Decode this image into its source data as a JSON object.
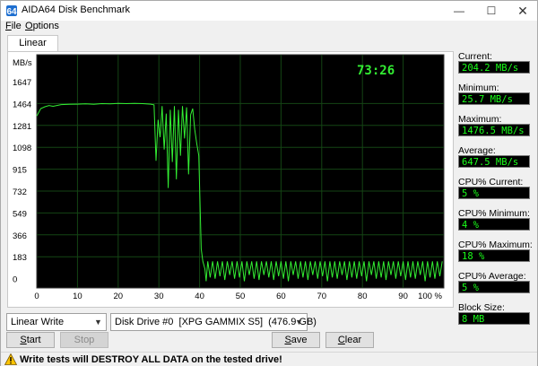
{
  "window": {
    "title": "AIDA64 Disk Benchmark",
    "controls": {
      "minimize": "—",
      "maximize": "☐",
      "close": "✕"
    }
  },
  "menu": [
    {
      "label": "File",
      "accel": "F",
      "rest": "ile"
    },
    {
      "label": "Options",
      "accel": "O",
      "rest": "ptions"
    }
  ],
  "tab": {
    "label": "Linear Write"
  },
  "chart_data": {
    "type": "line",
    "title": "",
    "ylabel": "MB/s",
    "xlabel": "",
    "timer": "73:26",
    "y_ticks": [
      "1647",
      "1464",
      "1281",
      "1098",
      "915",
      "732",
      "549",
      "366",
      "183",
      "0"
    ],
    "x_ticks": [
      "0",
      "10",
      "20",
      "30",
      "40",
      "50",
      "60",
      "70",
      "80",
      "90",
      "100 %"
    ],
    "xlim": [
      0,
      100
    ],
    "ylim": [
      0,
      1647
    ],
    "grid": true,
    "background": "#000000",
    "grid_color": "#144514",
    "line_color": "#33ee33",
    "series": [
      {
        "values": [
          [
            0,
            1370
          ],
          [
            1,
            1430
          ],
          [
            2,
            1445
          ],
          [
            3,
            1455
          ],
          [
            4,
            1448
          ],
          [
            6,
            1462
          ],
          [
            8,
            1465
          ],
          [
            10,
            1466
          ],
          [
            12,
            1468
          ],
          [
            14,
            1465
          ],
          [
            16,
            1470
          ],
          [
            18,
            1468
          ],
          [
            20,
            1472
          ],
          [
            22,
            1470
          ],
          [
            24,
            1472
          ],
          [
            26,
            1470
          ],
          [
            28,
            1466
          ],
          [
            28.8,
            1460
          ],
          [
            29.3,
            1010
          ],
          [
            29.8,
            1340
          ],
          [
            30.3,
            1200
          ],
          [
            30.8,
            1450
          ],
          [
            31.3,
            1100
          ],
          [
            31.8,
            1390
          ],
          [
            32.3,
            790
          ],
          [
            32.8,
            1420
          ],
          [
            33.3,
            1000
          ],
          [
            33.8,
            1450
          ],
          [
            34.3,
            860
          ],
          [
            34.8,
            1420
          ],
          [
            35.3,
            1050
          ],
          [
            35.8,
            1450
          ],
          [
            36.3,
            1190
          ],
          [
            36.8,
            1440
          ],
          [
            37.3,
            900
          ],
          [
            37.8,
            1380
          ],
          [
            38.3,
            1430
          ],
          [
            38.8,
            1260
          ],
          [
            39.3,
            1150
          ],
          [
            39.8,
            1050
          ],
          [
            40.4,
            300
          ],
          [
            40.8,
            200
          ],
          [
            41.3,
            140
          ],
          [
            41.6,
            40
          ],
          [
            42.0,
            200
          ],
          [
            42.6,
            70
          ],
          [
            43.2,
            200
          ],
          [
            43.8,
            60
          ],
          [
            44.4,
            200
          ],
          [
            45.0,
            80
          ],
          [
            45.6,
            200
          ],
          [
            46.2,
            50
          ],
          [
            46.8,
            200
          ],
          [
            47.4,
            90
          ],
          [
            48.0,
            200
          ],
          [
            48.6,
            60
          ],
          [
            49.2,
            200
          ],
          [
            49.8,
            70
          ],
          [
            50.4,
            200
          ],
          [
            51.0,
            40
          ],
          [
            51.6,
            200
          ],
          [
            52.2,
            90
          ],
          [
            52.8,
            200
          ],
          [
            53.4,
            60
          ],
          [
            54.0,
            200
          ],
          [
            54.6,
            50
          ],
          [
            55.2,
            200
          ],
          [
            55.8,
            90
          ],
          [
            56.4,
            200
          ],
          [
            57.0,
            70
          ],
          [
            57.6,
            200
          ],
          [
            58.2,
            50
          ],
          [
            58.8,
            200
          ],
          [
            59.4,
            80
          ],
          [
            60.0,
            200
          ],
          [
            60.6,
            60
          ],
          [
            61.2,
            200
          ],
          [
            61.8,
            40
          ],
          [
            62.4,
            200
          ],
          [
            63.0,
            90
          ],
          [
            63.6,
            200
          ],
          [
            64.2,
            60
          ],
          [
            64.8,
            200
          ],
          [
            65.4,
            70
          ],
          [
            66.0,
            200
          ],
          [
            66.6,
            50
          ],
          [
            67.2,
            200
          ],
          [
            67.8,
            90
          ],
          [
            68.4,
            200
          ],
          [
            69.0,
            60
          ],
          [
            69.6,
            200
          ],
          [
            70.2,
            80
          ],
          [
            70.8,
            200
          ],
          [
            71.4,
            40
          ],
          [
            72.0,
            200
          ],
          [
            72.6,
            70
          ],
          [
            73.2,
            200
          ],
          [
            73.8,
            60
          ],
          [
            74.4,
            200
          ],
          [
            75.0,
            90
          ],
          [
            75.6,
            200
          ],
          [
            76.2,
            50
          ],
          [
            76.8,
            200
          ],
          [
            77.4,
            70
          ],
          [
            78.0,
            200
          ],
          [
            78.6,
            60
          ],
          [
            79.2,
            200
          ],
          [
            79.8,
            80
          ],
          [
            80.4,
            200
          ],
          [
            81.0,
            40
          ],
          [
            81.6,
            200
          ],
          [
            82.2,
            90
          ],
          [
            82.8,
            200
          ],
          [
            83.4,
            60
          ],
          [
            84.0,
            200
          ],
          [
            84.6,
            70
          ],
          [
            85.2,
            200
          ],
          [
            85.8,
            50
          ],
          [
            86.4,
            200
          ],
          [
            87.0,
            90
          ],
          [
            87.6,
            200
          ],
          [
            88.2,
            60
          ],
          [
            88.8,
            200
          ],
          [
            89.4,
            80
          ],
          [
            90.0,
            200
          ],
          [
            90.6,
            50
          ],
          [
            91.2,
            200
          ],
          [
            91.8,
            70
          ],
          [
            92.4,
            200
          ],
          [
            93.0,
            60
          ],
          [
            93.6,
            200
          ],
          [
            94.2,
            90
          ],
          [
            94.8,
            200
          ],
          [
            95.4,
            40
          ],
          [
            96.0,
            200
          ],
          [
            96.6,
            70
          ],
          [
            97.2,
            200
          ],
          [
            97.8,
            60
          ],
          [
            98.4,
            200
          ],
          [
            99.0,
            80
          ],
          [
            99.6,
            200
          ]
        ]
      }
    ]
  },
  "stats": [
    {
      "label": "Current:",
      "value": "204.2 MB/s"
    },
    {
      "label": "Minimum:",
      "value": "25.7 MB/s"
    },
    {
      "label": "Maximum:",
      "value": "1476.5 MB/s"
    },
    {
      "label": "Average:",
      "value": "647.5 MB/s"
    },
    {
      "label": "CPU% Current:",
      "value": "5 %"
    },
    {
      "label": "CPU% Minimum:",
      "value": "4 %"
    },
    {
      "label": "CPU% Maximum:",
      "value": "18 %"
    },
    {
      "label": "CPU% Average:",
      "value": "5 %"
    },
    {
      "label": "Block Size:",
      "value": "8 MB"
    }
  ],
  "controls": {
    "test_select": "Linear Write",
    "drive_select": "Disk Drive #0  [XPG GAMMIX S5]  (476.9 GB)",
    "start": {
      "label": "Start",
      "accel": "S",
      "rest": "tart"
    },
    "stop": {
      "label": "Stop"
    },
    "save": {
      "label": "Save",
      "accel": "S",
      "rest": "ave"
    },
    "clear": {
      "label": "Clear",
      "accel": "C",
      "rest": "lear"
    }
  },
  "status": {
    "warning": "Write tests will DESTROY ALL DATA on the tested drive!"
  }
}
